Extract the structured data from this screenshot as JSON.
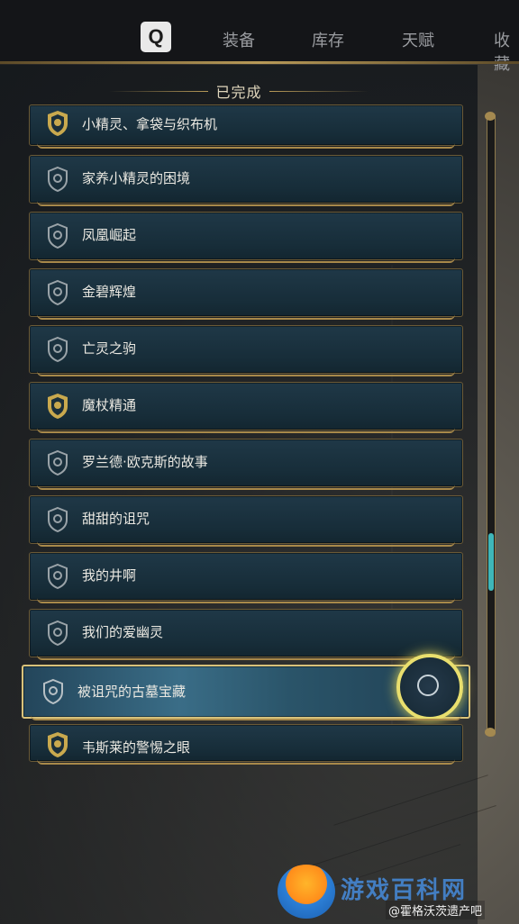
{
  "topbar": {
    "key_hint": "Q",
    "tabs": [
      "装备",
      "库存",
      "天赋",
      "收藏"
    ]
  },
  "section": {
    "title": "已完成"
  },
  "quests": [
    {
      "label": "小精灵、拿袋与织布机",
      "icon": "gold-crest-icon"
    },
    {
      "label": "家养小精灵的困境",
      "icon": "shield-crest-icon"
    },
    {
      "label": "凤凰崛起",
      "icon": "shield-crest-icon"
    },
    {
      "label": "金碧辉煌",
      "icon": "shield-crest-icon"
    },
    {
      "label": "亡灵之驹",
      "icon": "shield-crest-icon"
    },
    {
      "label": "魔杖精通",
      "icon": "gold-crest-icon"
    },
    {
      "label": "罗兰德·欧克斯的故事",
      "icon": "shield-crest-icon"
    },
    {
      "label": "甜甜的诅咒",
      "icon": "shield-crest-icon"
    },
    {
      "label": "我的井啊",
      "icon": "shield-crest-icon"
    },
    {
      "label": "我们的爱幽灵",
      "icon": "shield-crest-icon"
    },
    {
      "label": "被诅咒的古墓宝藏",
      "icon": "shield-crest-icon",
      "selected": true
    },
    {
      "label": "韦斯莱的警惕之眼",
      "icon": "gold-crest-icon"
    }
  ],
  "colors": {
    "gold": "#b89a58",
    "row_bg": "#1f3847",
    "scroll_thumb": "#3fb7b9",
    "selection_ring": "#e9df6e"
  },
  "watermark": {
    "site": "游戏百科网",
    "tag": "@霍格沃茨遗产吧"
  }
}
